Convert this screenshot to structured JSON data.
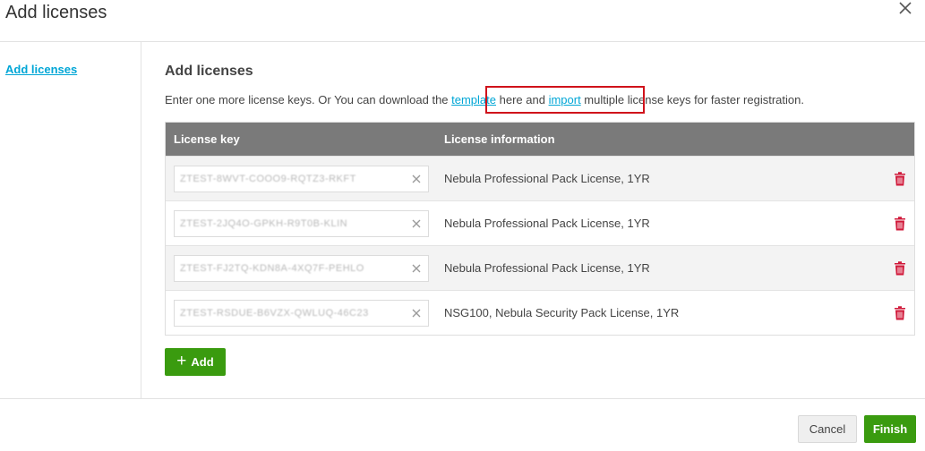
{
  "window": {
    "title": "Add licenses"
  },
  "sidebar": {
    "items": [
      {
        "label": "Add licenses"
      }
    ]
  },
  "main": {
    "title": "Add licenses",
    "description": {
      "before": "Enter one more license keys. Or You can download the ",
      "template_link": "template",
      "middle": " here and ",
      "import_link": "import",
      "after": " multiple license keys for faster registration."
    }
  },
  "table": {
    "headers": {
      "key": "License key",
      "info": "License information"
    },
    "rows": [
      {
        "key": "ZTEST-8WVT-COOO9-RQTZ3-RKFT",
        "info": "Nebula Professional Pack License, 1YR"
      },
      {
        "key": "ZTEST-2JQ4O-GPKH-R9T0B-KLIN",
        "info": "Nebula Professional Pack License, 1YR"
      },
      {
        "key": "ZTEST-FJ2TQ-KDN8A-4XQ7F-PEHLO",
        "info": "Nebula Professional Pack License, 1YR"
      },
      {
        "key": "ZTEST-RSDUE-B6VZX-QWLUQ-46C23",
        "info": "NSG100, Nebula Security Pack License, 1YR"
      }
    ]
  },
  "buttons": {
    "add": "Add",
    "cancel": "Cancel",
    "finish": "Finish"
  },
  "colors": {
    "accent_green": "#3a9b0f",
    "link_blue": "#00a6d6",
    "delete_red": "#d0193a",
    "highlight_red": "#d0121b",
    "header_gray": "#7a7a7a"
  },
  "icons": {
    "close": "close-icon",
    "clear": "clear-x-icon",
    "delete": "trash-icon",
    "add": "plus-icon"
  }
}
